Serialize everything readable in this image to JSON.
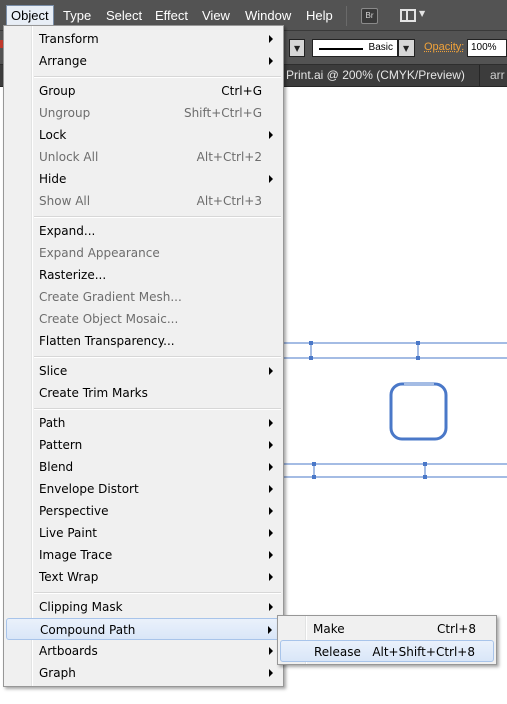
{
  "menubar": {
    "items": [
      {
        "label": "Object",
        "active": true
      },
      {
        "label": "Type"
      },
      {
        "label": "Select"
      },
      {
        "label": "Effect"
      },
      {
        "label": "View"
      },
      {
        "label": "Window"
      },
      {
        "label": "Help"
      }
    ],
    "bridge_icon_label": "Br"
  },
  "controlbar": {
    "stroke_profile": "Basic",
    "opacity_label": "Opacity:",
    "opacity_value": "100%"
  },
  "tabs": [
    {
      "label": "Print.ai @ 200% (CMYK/Preview)"
    },
    {
      "label": "arr"
    }
  ],
  "object_menu": {
    "items": [
      {
        "label": "Transform",
        "submenu": true
      },
      {
        "label": "Arrange",
        "submenu": true
      },
      {
        "label": "Group",
        "shortcut": "Ctrl+G"
      },
      {
        "label": "Ungroup",
        "shortcut": "Shift+Ctrl+G",
        "disabled": true
      },
      {
        "label": "Lock",
        "submenu": true
      },
      {
        "label": "Unlock All",
        "shortcut": "Alt+Ctrl+2",
        "disabled": true
      },
      {
        "label": "Hide",
        "submenu": true
      },
      {
        "label": "Show All",
        "shortcut": "Alt+Ctrl+3",
        "disabled": true
      },
      {
        "label": "Expand..."
      },
      {
        "label": "Expand Appearance",
        "disabled": true
      },
      {
        "label": "Rasterize..."
      },
      {
        "label": "Create Gradient Mesh...",
        "disabled": true
      },
      {
        "label": "Create Object Mosaic...",
        "disabled": true
      },
      {
        "label": "Flatten Transparency..."
      },
      {
        "label": "Slice",
        "submenu": true
      },
      {
        "label": "Create Trim Marks"
      },
      {
        "label": "Path",
        "submenu": true
      },
      {
        "label": "Pattern",
        "submenu": true
      },
      {
        "label": "Blend",
        "submenu": true
      },
      {
        "label": "Envelope Distort",
        "submenu": true
      },
      {
        "label": "Perspective",
        "submenu": true
      },
      {
        "label": "Live Paint",
        "submenu": true
      },
      {
        "label": "Image Trace",
        "submenu": true
      },
      {
        "label": "Text Wrap",
        "submenu": true
      },
      {
        "label": "Clipping Mask",
        "submenu": true
      },
      {
        "label": "Compound Path",
        "submenu": true,
        "highlighted": true
      },
      {
        "label": "Artboards",
        "submenu": true
      },
      {
        "label": "Graph",
        "submenu": true
      }
    ]
  },
  "compound_path_submenu": {
    "items": [
      {
        "label": "Make",
        "shortcut": "Ctrl+8"
      },
      {
        "label": "Release",
        "shortcut": "Alt+Shift+Ctrl+8",
        "highlighted": true
      }
    ]
  },
  "colors": {
    "app_chrome": "#535353",
    "selection_path": "#4a78c8",
    "opacity_label": "#f0a23a",
    "menu_bg": "#f0f0f0",
    "menu_highlight": "#d9e6f8"
  }
}
